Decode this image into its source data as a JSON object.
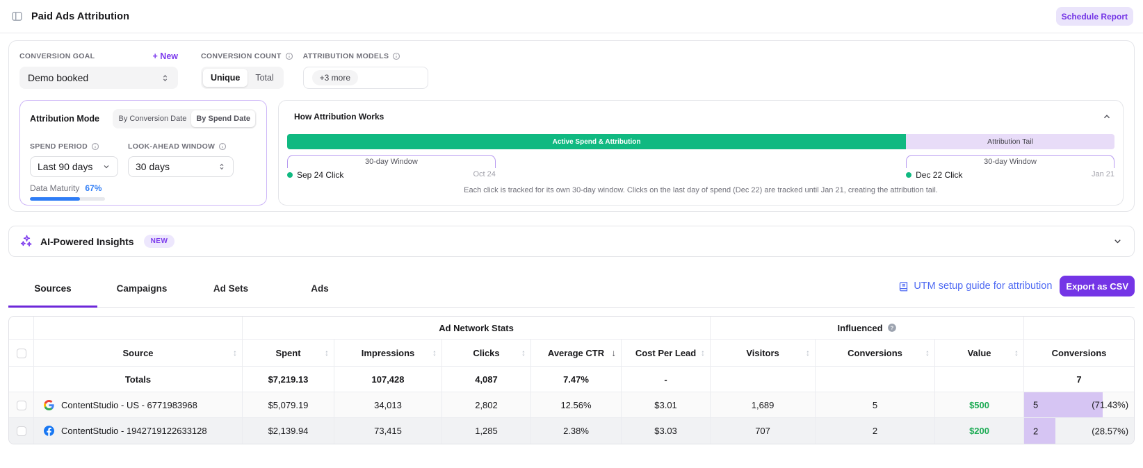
{
  "header": {
    "title": "Paid Ads Attribution",
    "schedule_report_label": "Schedule Report"
  },
  "filters": {
    "conversion_goal": {
      "label": "CONVERSION GOAL",
      "new_label": "+ New",
      "value": "Demo booked"
    },
    "conversion_count": {
      "label": "CONVERSION COUNT",
      "options": [
        "Unique",
        "Total"
      ],
      "selected": "Unique"
    },
    "attribution_models": {
      "label": "ATTRIBUTION MODELS",
      "more_label": "+3 more"
    }
  },
  "attribution_mode": {
    "title": "Attribution Mode",
    "tabs": [
      "By Conversion Date",
      "By Spend Date"
    ],
    "selected_tab": "By Spend Date",
    "spend_period": {
      "label": "SPEND PERIOD",
      "value": "Last 90 days"
    },
    "look_ahead": {
      "label": "LOOK-AHEAD WINDOW",
      "value": "30 days"
    },
    "data_maturity": {
      "label": "Data Maturity",
      "value": "67%",
      "percent": 67
    }
  },
  "how_attribution_works": {
    "title": "How Attribution Works",
    "active_bar_label": "Active Spend & Attribution",
    "tail_bar_label": "Attribution Tail",
    "green_percent": 74.8,
    "tail_percent": 25.2,
    "window1_label": "30-day Window",
    "window2_label": "30-day Window",
    "click1_label": "Sep 24 Click",
    "click1_end": "Oct 24",
    "click2_label": "Dec 22 Click",
    "click2_end": "Jan 21",
    "caption": "Each click is tracked for its own 30-day window. Clicks on the last day of spend (Dec 22) are tracked until Jan 21, creating the attribution tail."
  },
  "insights": {
    "title": "AI-Powered Insights",
    "badge": "NEW"
  },
  "tabs": {
    "items": [
      "Sources",
      "Campaigns",
      "Ad Sets",
      "Ads"
    ],
    "selected": "Sources"
  },
  "actions": {
    "utm_link": "UTM setup guide for attribution",
    "export_label": "Export as CSV"
  },
  "table": {
    "groups": {
      "ad_network": "Ad Network Stats",
      "influenced": "Influenced"
    },
    "columns": [
      {
        "label": "Source",
        "sort": "both"
      },
      {
        "label": "Spent",
        "sort": "both"
      },
      {
        "label": "Impressions",
        "sort": "both"
      },
      {
        "label": "Clicks",
        "sort": "both"
      },
      {
        "label": "Average CTR",
        "sort": "desc"
      },
      {
        "label": "Cost Per Lead",
        "sort": "both"
      },
      {
        "label": "Visitors",
        "sort": "both"
      },
      {
        "label": "Conversions",
        "sort": "both"
      },
      {
        "label": "Value",
        "sort": "both"
      },
      {
        "label": "Conversions",
        "sort": "none"
      }
    ],
    "totals": {
      "label": "Totals",
      "spent": "$7,219.13",
      "impressions": "107,428",
      "clicks": "4,087",
      "avg_ctr": "7.47%",
      "cost_per_lead": "-",
      "conversions": "7"
    },
    "rows": [
      {
        "network": "google",
        "source": "ContentStudio - US - 6771983968",
        "spent": "$5,079.19",
        "impressions": "34,013",
        "clicks": "2,802",
        "avg_ctr": "12.56%",
        "cost_per_lead": "$3.01",
        "visitors": "1,689",
        "conversions": "5",
        "value": "$500",
        "conv_count": "5",
        "conv_pct": "(71.43%)",
        "bar_percent": 71.43
      },
      {
        "network": "facebook",
        "source": "ContentStudio - 1942719122633128",
        "spent": "$2,139.94",
        "impressions": "73,415",
        "clicks": "1,285",
        "avg_ctr": "2.38%",
        "cost_per_lead": "$3.03",
        "visitors": "707",
        "conversions": "2",
        "value": "$200",
        "conv_count": "2",
        "conv_pct": "(28.57%)",
        "bar_percent": 28.57
      }
    ]
  }
}
